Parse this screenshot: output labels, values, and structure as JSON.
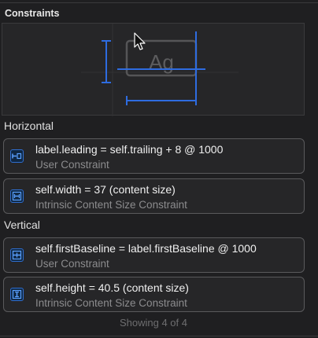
{
  "section_title": "Constraints",
  "preview": {
    "sample_text": "Ag"
  },
  "groups": {
    "horizontal": "Horizontal",
    "vertical": "Vertical"
  },
  "constraints": [
    {
      "primary": "label.leading = self.trailing + 8 @ 1000",
      "secondary": "User Constraint",
      "icon": "leading-trailing-constraint-icon"
    },
    {
      "primary": "self.width = 37 (content size)",
      "secondary": "Intrinsic Content Size Constraint",
      "icon": "width-constraint-icon"
    },
    {
      "primary": "self.firstBaseline = label.firstBaseline @ 1000",
      "secondary": "User Constraint",
      "icon": "baseline-constraint-icon"
    },
    {
      "primary": "self.height = 40.5 (content size)",
      "secondary": "Intrinsic Content Size Constraint",
      "icon": "height-constraint-icon"
    }
  ],
  "footer": "Showing 4 of 4",
  "colors": {
    "accent": "#2f6fd1",
    "constraint_line": "#2e6ce0",
    "card_border": "#5a5a5c"
  }
}
